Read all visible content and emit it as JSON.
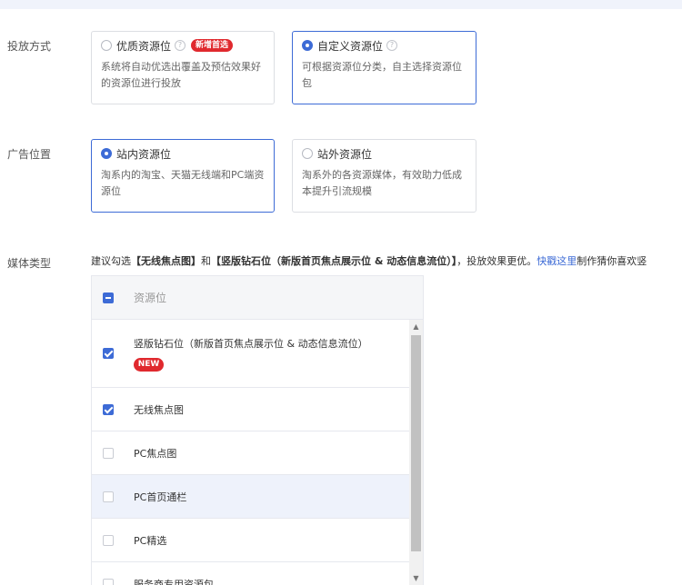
{
  "delivery": {
    "label": "投放方式",
    "options": [
      {
        "title": "优质资源位",
        "badge": "新增首选",
        "desc": "系统将自动优选出覆盖及预估效果好的资源位进行投放",
        "selected": false
      },
      {
        "title": "自定义资源位",
        "desc": "可根据资源位分类，自主选择资源位包",
        "selected": true
      }
    ]
  },
  "placement": {
    "label": "广告位置",
    "options": [
      {
        "title": "站内资源位",
        "desc": "淘系内的淘宝、天猫无线端和PC端资源位",
        "selected": true
      },
      {
        "title": "站外资源位",
        "desc": "淘系外的各资源媒体，有效助力低成本提升引流规模",
        "selected": false
      }
    ]
  },
  "media": {
    "label": "媒体类型",
    "tip": {
      "prefix": "建议勾选",
      "bold1": "【无线焦点图】",
      "mid": "和",
      "bold2": "【竖版钻石位（新版首页焦点展示位 & 动态信息流位）】",
      "suffix": "，投放效果更优。",
      "link": "快戳这里",
      "tail": "制作猜你喜欢竖"
    },
    "table": {
      "header": "资源位",
      "rows": [
        {
          "label": "竖版钻石位（新版首页焦点展示位 & 动态信息流位）",
          "badge": "NEW",
          "checked": true
        },
        {
          "label": "无线焦点图",
          "checked": true
        },
        {
          "label": "PC焦点图",
          "checked": false
        },
        {
          "label": "PC首页通栏",
          "checked": false
        },
        {
          "label": "PC精选",
          "checked": false
        },
        {
          "label": "服务商专用资源包",
          "checked": false
        }
      ]
    }
  },
  "icons": {
    "help": "?",
    "scroll_up": "▲",
    "scroll_down": "▼"
  },
  "colors": {
    "accent": "#3d6bd6",
    "badge_red": "#e0292e",
    "row_hover": "#eef2fb"
  }
}
